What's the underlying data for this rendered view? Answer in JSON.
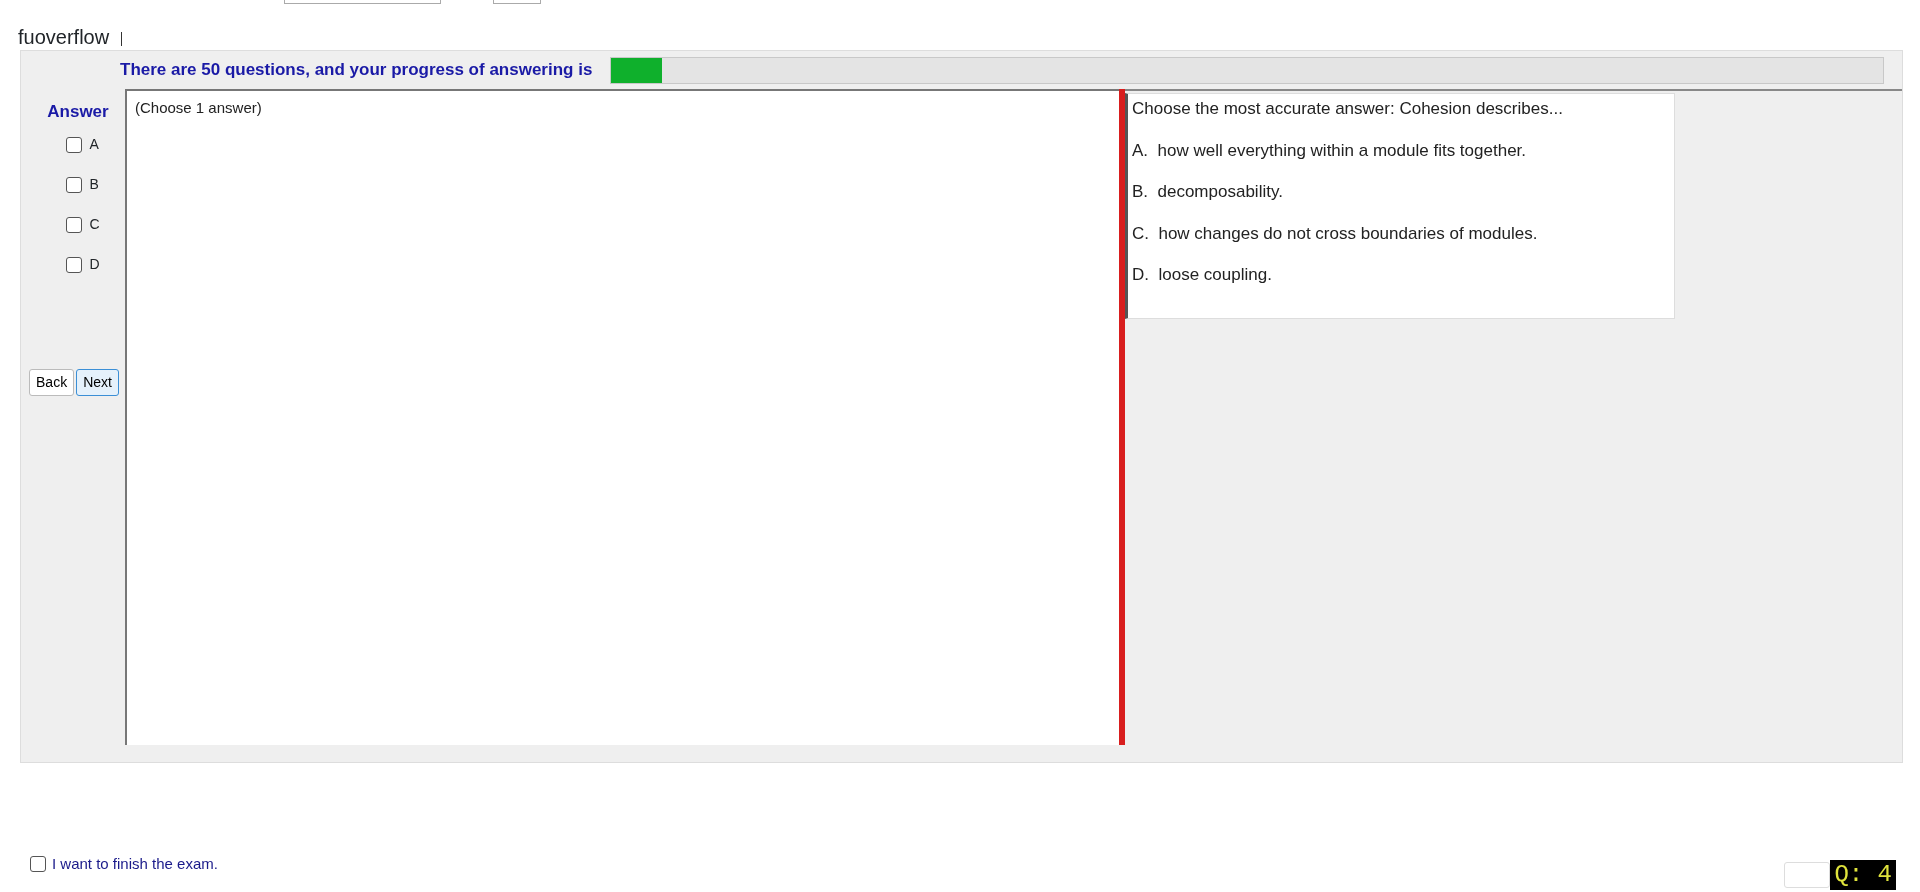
{
  "app_label": "fuoverflow",
  "progress": {
    "text": "There are 50 questions, and your progress of answering is",
    "level": 0.04
  },
  "answer": {
    "label": "Answer",
    "options": [
      {
        "letter": "A",
        "checked": false
      },
      {
        "letter": "B",
        "checked": false
      },
      {
        "letter": "C",
        "checked": false
      },
      {
        "letter": "D",
        "checked": false
      }
    ]
  },
  "buttons": [
    {
      "label": "Back",
      "selected": false
    },
    {
      "label": "Next",
      "selected": true
    }
  ],
  "answer_box": {
    "hint": "(Choose 1 answer)"
  },
  "question": {
    "prompt": "Choose the most accurate answer: Cohesion describes...",
    "choices": [
      {
        "letter": "A.",
        "text": "how well everything within a module fits together."
      },
      {
        "letter": "B.",
        "text": "decomposability."
      },
      {
        "letter": "C.",
        "text": "how changes do not cross boundaries of modules."
      },
      {
        "letter": "D.",
        "text": "loose coupling."
      }
    ]
  },
  "finish": {
    "label": "I want to finish the exam.",
    "checked": false
  },
  "question_number": "Q: 4"
}
